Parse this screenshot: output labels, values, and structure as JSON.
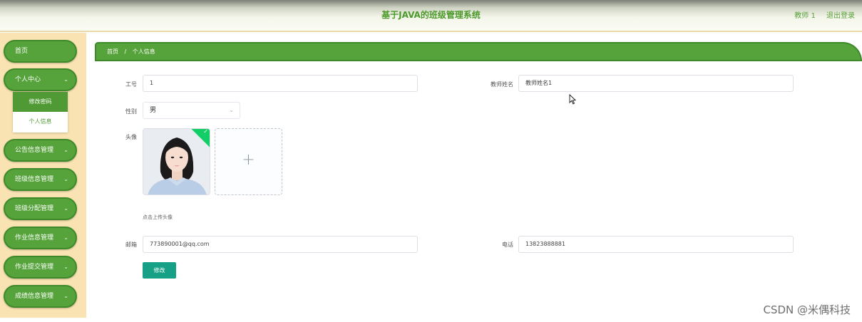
{
  "header": {
    "title": "基于JAVA的班级管理系统",
    "user": "教师 1",
    "logout": "退出登录"
  },
  "sidebar": {
    "items": [
      {
        "label": "首页"
      },
      {
        "label": "个人中心"
      },
      {
        "label": "公告信息管理"
      },
      {
        "label": "班级信息管理"
      },
      {
        "label": "班级分配管理"
      },
      {
        "label": "作业信息管理"
      },
      {
        "label": "作业提交管理"
      },
      {
        "label": "成绩信息管理"
      }
    ],
    "submenu": [
      {
        "label": "修改密码"
      },
      {
        "label": "个人信息"
      }
    ]
  },
  "breadcrumb": {
    "home": "首页",
    "separator": "/",
    "current": "个人信息"
  },
  "form": {
    "id_label": "工号",
    "id_value": "1",
    "name_label": "教师姓名",
    "name_value": "教师姓名1",
    "gender_label": "性别",
    "gender_value": "男",
    "avatar_label": "头像",
    "upload_tip": "点击上传头像",
    "email_label": "邮箱",
    "email_value": "773890001@qq.com",
    "phone_label": "电话",
    "phone_value": "13823888881",
    "submit_label": "修改"
  },
  "watermark": "CSDN @米偶科技",
  "colors": {
    "primary_green": "#55a33a",
    "sidebar_bg": "#fae3b3",
    "button_teal": "#16a085",
    "upload_badge": "#13ce66"
  }
}
